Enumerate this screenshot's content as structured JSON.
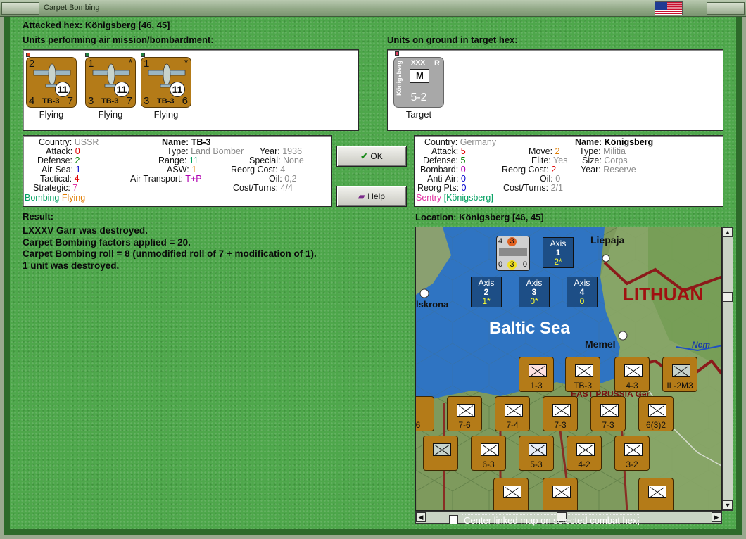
{
  "window": {
    "title": "Carpet Bombing"
  },
  "attacked_hex": "Attacked hex: Königsberg  [46, 45]",
  "air_units_label": "Units performing air mission/bombardment:",
  "ground_units_label": "Units on ground in target hex:",
  "air_units": [
    {
      "attack": "2",
      "defense": "4",
      "value_br": "7",
      "name": "TB-3",
      "strength": "11",
      "star": "",
      "status": "Flying"
    },
    {
      "attack": "1",
      "defense": "3",
      "value_br": "7",
      "name": "TB-3",
      "strength": "11",
      "star": "*",
      "status": "Flying"
    },
    {
      "attack": "1",
      "defense": "3",
      "value_br": "6",
      "name": "TB-3",
      "strength": "11",
      "star": "*",
      "status": "Flying"
    }
  ],
  "ground_unit": {
    "size": "XXX",
    "flag": "R",
    "name": "Königsberg",
    "strength": "5-2",
    "status": "Target"
  },
  "attacker_stats": {
    "country_k": "Country:",
    "country_v": "USSR",
    "attack_k": "Attack:",
    "attack_v": "0",
    "defense_k": "Defense:",
    "defense_v": "2",
    "airsea_k": "Air-Sea:",
    "airsea_v": "1",
    "tactical_k": "Tactical:",
    "tactical_v": "4",
    "strategic_k": "Strategic:",
    "strategic_v": "7",
    "mode1": "Bombing",
    "mode2": "Flying",
    "name_k": "Name:",
    "name_v": "TB-3",
    "type_k": "Type:",
    "type_v": "Land Bomber",
    "year_k": "Year:",
    "year_v": "1936",
    "range_k": "Range:",
    "range_v": "11",
    "special_k": "Special:",
    "special_v": "None",
    "asw_k": "ASW:",
    "asw_v": "1",
    "reorg_k": "Reorg Cost:",
    "reorg_v": "4",
    "airtrans_k": "Air Transport:",
    "airtrans_v": "T+P",
    "oil_k": "Oil:",
    "oil_v": "0,2",
    "cost_k": "Cost/Turns:",
    "cost_v": "4/4"
  },
  "defender_stats": {
    "country_k": "Country:",
    "country_v": "Germany",
    "attack_k": "Attack:",
    "attack_v": "5",
    "defense_k": "Defense:",
    "defense_v": "5",
    "bombard_k": "Bombard:",
    "bombard_v": "0",
    "antiair_k": "Anti-Air:",
    "antiair_v": "0",
    "reorgpts_k": "Reorg Pts:",
    "reorgpts_v": "0",
    "move_k": "Move:",
    "move_v": "2",
    "elite_k": "Elite:",
    "elite_v": "Yes",
    "reorg_k": "Reorg Cost:",
    "reorg_v": "2",
    "oil_k": "Oil:",
    "oil_v": "0",
    "cost_k": "Cost/Turns:",
    "cost_v": "2/1",
    "name_k": "Name:",
    "name_v": "Königsberg",
    "type_k": "Type:",
    "type_v": "Militia",
    "size_k": "Size:",
    "size_v": "Corps",
    "year_k": "Year:",
    "year_v": "Reserve",
    "mode1": "Sentry",
    "mode2": "[Königsberg]"
  },
  "buttons": {
    "ok": "OK",
    "help": "Help"
  },
  "result_label": "Result:",
  "result_lines": [
    "LXXXV Garr was destroyed.",
    "Carpet Bombing factors applied = 20.",
    "Carpet Bombing roll = 8 (unmodified roll of 7 + modification of 1).",
    "1 unit was destroyed."
  ],
  "location_label": "Location: Königsberg  [46, 45]",
  "map": {
    "labels": {
      "sea": "Baltic Sea",
      "country": "LITHUAN",
      "liepaja": "Liepaja",
      "karlskrona": "lskrona",
      "memel": "Memel",
      "nemunas": "Nem",
      "prussia": "EAST PRUSSIA Ger"
    },
    "axis_boxes": [
      {
        "title": "Axis",
        "count": "1",
        "sub": "2*"
      },
      {
        "title": "Axis",
        "count": "2",
        "sub": "1*"
      },
      {
        "title": "Axis",
        "count": "3",
        "sub": "0*"
      },
      {
        "title": "Axis",
        "count": "4",
        "sub": "0"
      }
    ],
    "naval_box": {
      "a": "4",
      "b": "3",
      "c": "0",
      "d": "3",
      "e": "0"
    },
    "counters": [
      {
        "str": "1-3"
      },
      {
        "str": "4-3"
      },
      {
        "str": "7-6"
      },
      {
        "str": "7-4"
      },
      {
        "str": "7-3"
      },
      {
        "str": "7-3"
      },
      {
        "str": "6(3)2"
      },
      {
        "str": "6-3"
      },
      {
        "str": "5-3"
      },
      {
        "str": "4-2"
      },
      {
        "str": "3-2"
      },
      {
        "str": "-6"
      },
      {
        "str": "TB-3"
      },
      {
        "str": "IL-2M3"
      }
    ]
  },
  "checkbox": {
    "label": "Center linked map on selected combat hex"
  }
}
